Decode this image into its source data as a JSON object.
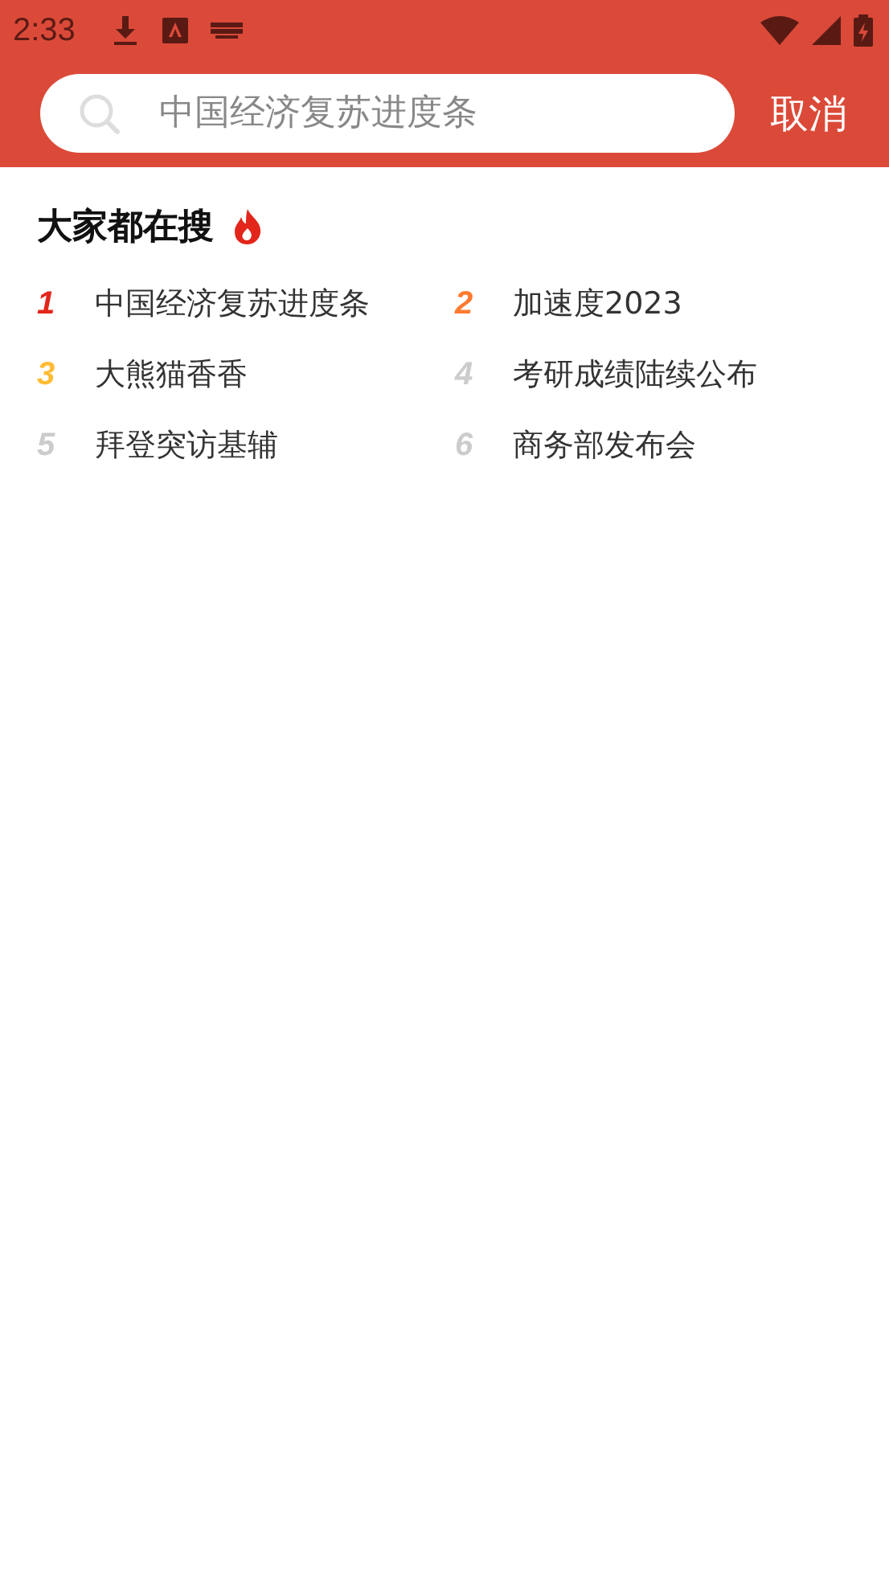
{
  "status_bar": {
    "time": "2:33"
  },
  "search": {
    "placeholder": "中国经济复苏进度条",
    "cancel": "取消"
  },
  "hot": {
    "title": "大家都在搜",
    "items": [
      {
        "rank": "1",
        "text": "中国经济复苏进度条",
        "color": "#e3261b"
      },
      {
        "rank": "2",
        "text": "加速度2023",
        "color": "#ff7a30"
      },
      {
        "rank": "3",
        "text": "大熊猫香香",
        "color": "#ffbb33"
      },
      {
        "rank": "4",
        "text": "考研成绩陆续公布",
        "color": "#cccccc"
      },
      {
        "rank": "5",
        "text": "拜登突访基辅",
        "color": "#cccccc"
      },
      {
        "rank": "6",
        "text": "商务部发布会",
        "color": "#cccccc"
      }
    ]
  }
}
